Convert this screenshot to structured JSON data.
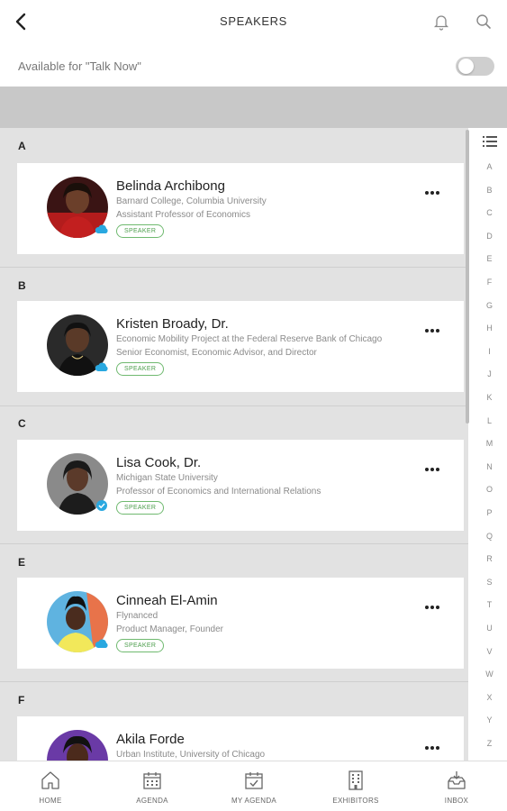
{
  "header": {
    "title": "SPEAKERS",
    "back_icon": "chevron-left-icon",
    "notification_icon": "bell-icon",
    "search_icon": "search-icon"
  },
  "talk_now": {
    "label": "Available for \"Talk Now\"",
    "enabled": false
  },
  "sections": [
    {
      "letter": "A",
      "speakers": [
        {
          "name": "Belinda Archibong",
          "org": "Barnard College, Columbia University",
          "role": "Assistant Professor of Economics",
          "tag": "SPEAKER",
          "status_icon": "cloud-icon"
        }
      ]
    },
    {
      "letter": "B",
      "speakers": [
        {
          "name": "Kristen Broady, Dr.",
          "org": "Economic Mobility Project at the Federal Reserve Bank of Chicago",
          "role": "Senior Economist, Economic Advisor, and Director",
          "tag": "SPEAKER",
          "status_icon": "cloud-icon"
        }
      ]
    },
    {
      "letter": "C",
      "speakers": [
        {
          "name": "Lisa Cook, Dr.",
          "org": "Michigan State University",
          "role": "Professor of Economics and International Relations",
          "tag": "SPEAKER",
          "status_icon": "verified-check-icon"
        }
      ]
    },
    {
      "letter": "E",
      "speakers": [
        {
          "name": "Cinneah El-Amin",
          "org": "Flynanced",
          "role": "Product Manager, Founder",
          "tag": "SPEAKER",
          "status_icon": "cloud-icon"
        }
      ]
    },
    {
      "letter": "F",
      "speakers": [
        {
          "name": "Akila Forde",
          "org": "Urban Institute, University of Chicago",
          "role": "",
          "tag": "",
          "status_icon": ""
        }
      ]
    }
  ],
  "index_letters": [
    "A",
    "B",
    "C",
    "D",
    "E",
    "F",
    "G",
    "H",
    "I",
    "J",
    "K",
    "L",
    "M",
    "N",
    "O",
    "P",
    "Q",
    "R",
    "S",
    "T",
    "U",
    "V",
    "W",
    "X",
    "Y",
    "Z"
  ],
  "bottom_nav": [
    {
      "label": "HOME",
      "icon": "home-icon"
    },
    {
      "label": "AGENDA",
      "icon": "calendar-icon"
    },
    {
      "label": "MY AGENDA",
      "icon": "calendar-check-icon"
    },
    {
      "label": "EXHIBITORS",
      "icon": "building-icon"
    },
    {
      "label": "INBOX",
      "icon": "inbox-icon"
    }
  ],
  "colors": {
    "tag_green": "#4c9e4c",
    "status_blue": "#29a8e0",
    "list_background": "#e2e2e2"
  }
}
